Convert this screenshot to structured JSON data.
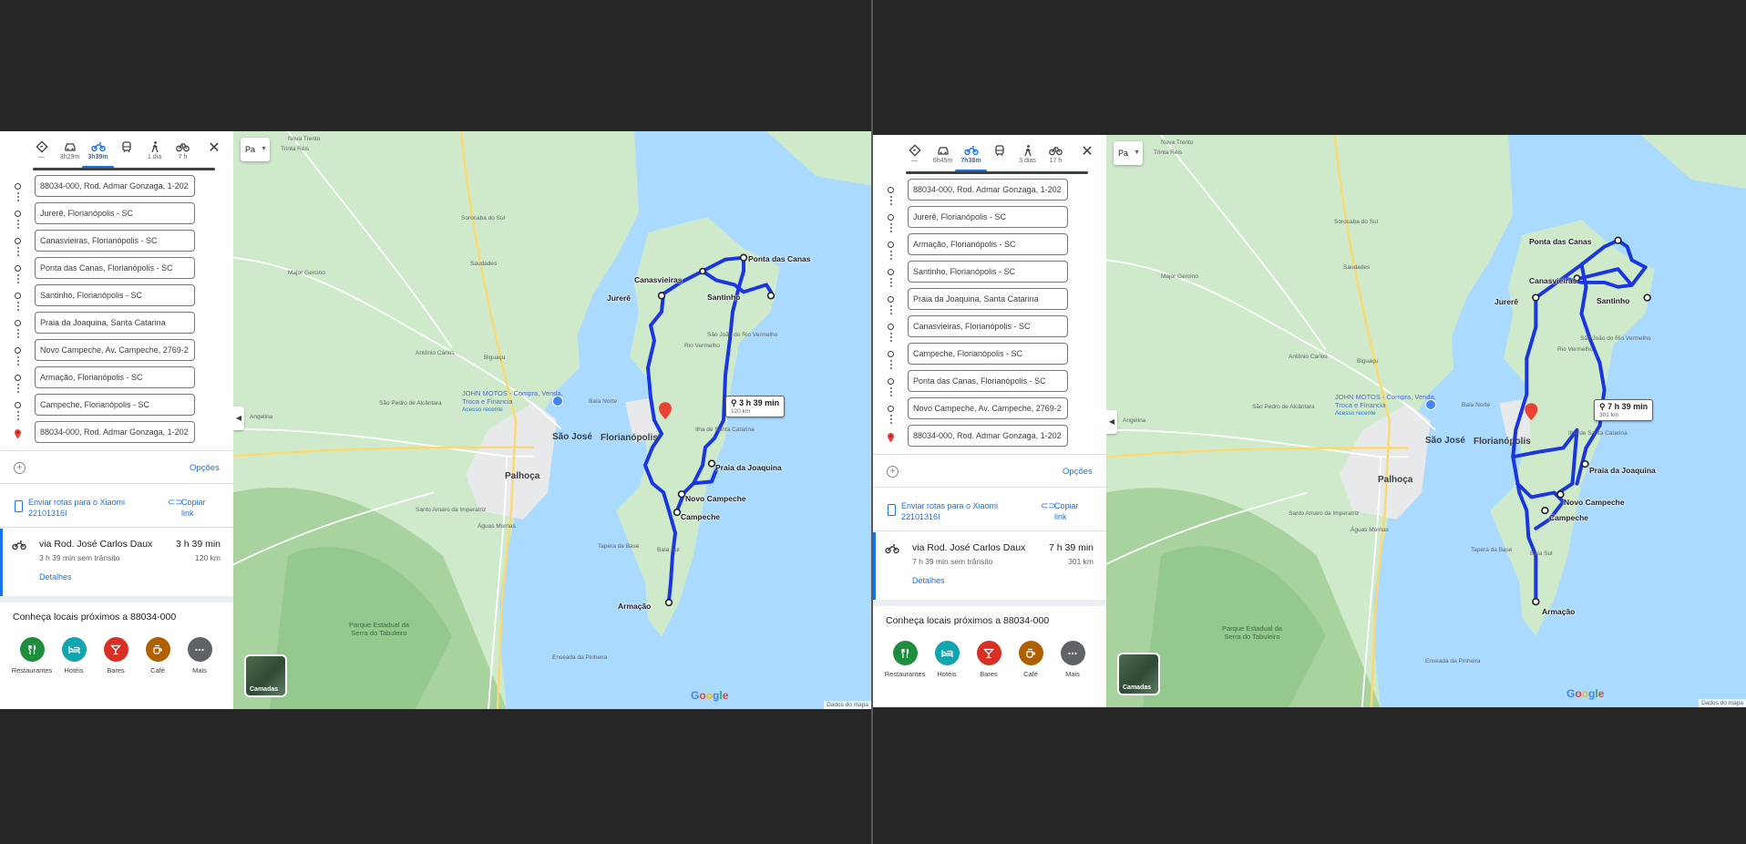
{
  "panes": [
    {
      "modes": [
        {
          "icon": "best-route-icon",
          "time": "—"
        },
        {
          "icon": "car-icon",
          "time": "3h29m"
        },
        {
          "icon": "motorcycle-icon",
          "time": "3h39m",
          "selected": true
        },
        {
          "icon": "transit-icon",
          "time": ""
        },
        {
          "icon": "walk-icon",
          "time": "1 dia"
        },
        {
          "icon": "bicycle-icon",
          "time": "7 h"
        }
      ],
      "stops": [
        "88034-000, Rod. Admar Gonzaga, 1-202",
        "Jurerê, Florianópolis - SC",
        "Canasvieiras, Florianópolis - SC",
        "Ponta das Canas, Florianópolis - SC",
        "Santinho, Florianópolis - SC",
        "Praia da Joaquina, Santa Catarina",
        "Novo Campeche, Av. Campeche, 2769-2",
        "Armação, Florianópolis - SC",
        "Campeche, Florianópolis - SC",
        "88034-000, Rod. Admar Gonzaga, 1-202"
      ],
      "options_label": "Opções",
      "send_label": "Enviar rotas para o Xiaomi 22101316I",
      "copy_label": "Copiar link",
      "route": {
        "title": "via Rod. José Carlos Daux",
        "time": "3 h 39 min",
        "subtitle": "3 h 39 min sem trânsito",
        "distance": "120 km",
        "details": "Detalhes"
      },
      "nearby_title": "Conheça locais próximos a 88034-000",
      "categories": [
        {
          "label": "Restaurantes",
          "icon": "restaurant-icon",
          "color": "#1e8e3e"
        },
        {
          "label": "Hotéis",
          "icon": "hotel-icon",
          "color": "#12a4af"
        },
        {
          "label": "Bares",
          "icon": "bar-icon",
          "color": "#d93025"
        },
        {
          "label": "Café",
          "icon": "coffee-icon",
          "color": "#b06000"
        },
        {
          "label": "Mais",
          "icon": "more-icon",
          "color": "#5f6368"
        }
      ],
      "map": {
        "layer_toggle": "Pa",
        "layers_label": "Camadas",
        "time_box": {
          "time": "3 h 39 min",
          "distance": "120 km"
        },
        "destinations": [
          "Ponta das Canas",
          "Canasvieiras",
          "Jurerê",
          "Santinho",
          "Praia da Joaquina",
          "Novo Campeche",
          "Campeche",
          "Armação"
        ],
        "cities": [
          "São José",
          "Florianópolis",
          "Palhoça"
        ],
        "places": [
          "Nova Trento",
          "Trinta Réis",
          "Antônio Carlos",
          "São Pedro de Alcântara",
          "Santo Amaro da Imperatriz",
          "Águas Mornas",
          "Angelina",
          "Major Gercino",
          "Sorocaba do Sul",
          "Saudades",
          "Biguaçu",
          "Rio Vermelho",
          "São João do Rio Vermelho",
          "Ilha de Santa Catarina",
          "Enseada da Pinheira",
          "Baía Norte",
          "Baía Sul",
          "Tapera da Base"
        ],
        "business": "JOHN MOTOS - Compra, Venda, Troca e Financia",
        "business_sub": "Acesso recente",
        "park": "Parque Estadual da Serra do Tabuleiro",
        "google": "Google",
        "attribution": "Dados do mapa"
      }
    },
    {
      "modes": [
        {
          "icon": "best-route-icon",
          "time": "—"
        },
        {
          "icon": "car-icon",
          "time": "6h45m"
        },
        {
          "icon": "motorcycle-icon",
          "time": "7h38m",
          "selected": true
        },
        {
          "icon": "transit-icon",
          "time": ""
        },
        {
          "icon": "walk-icon",
          "time": "3 dias"
        },
        {
          "icon": "bicycle-icon",
          "time": "17 h"
        }
      ],
      "stops": [
        "88034-000, Rod. Admar Gonzaga, 1-202",
        "Jurerê, Florianópolis - SC",
        "Armação, Florianópolis - SC",
        "Santinho, Florianópolis - SC",
        "Praia da Joaquina, Santa Catarina",
        "Canasvieiras, Florianópolis - SC",
        "Campeche, Florianópolis - SC",
        "Ponta das Canas, Florianópolis - SC",
        "Novo Campeche, Av. Campeche, 2769-2",
        "88034-000, Rod. Admar Gonzaga, 1-202"
      ],
      "options_label": "Opções",
      "send_label": "Enviar rotas para o Xiaomi 22101316I",
      "copy_label": "Copiar link",
      "route": {
        "title": "via Rod. José Carlos Daux",
        "time": "7 h 39 min",
        "subtitle": "7 h 39 min sem trânsito",
        "distance": "301 km",
        "details": "Detalhes"
      },
      "nearby_title": "Conheça locais próximos a 88034-000",
      "categories": [
        {
          "label": "Restaurantes",
          "icon": "restaurant-icon",
          "color": "#1e8e3e"
        },
        {
          "label": "Hotéis",
          "icon": "hotel-icon",
          "color": "#12a4af"
        },
        {
          "label": "Bares",
          "icon": "bar-icon",
          "color": "#d93025"
        },
        {
          "label": "Café",
          "icon": "coffee-icon",
          "color": "#b06000"
        },
        {
          "label": "Mais",
          "icon": "more-icon",
          "color": "#5f6368"
        }
      ],
      "map": {
        "layer_toggle": "Pa",
        "layers_label": "Camadas",
        "time_box": {
          "time": "7 h 39 min",
          "distance": "301 km"
        },
        "destinations": [
          "Ponta das Canas",
          "Canasvieiras",
          "Jurerê",
          "Santinho",
          "Praia da Joaquina",
          "Novo Campeche",
          "Campeche",
          "Armação"
        ],
        "cities": [
          "São José",
          "Florianópolis",
          "Palhoça"
        ],
        "places": [
          "Nova Trento",
          "Trinta Réis",
          "Antônio Carlos",
          "São Pedro de Alcântara",
          "Santo Amaro da Imperatriz",
          "Águas Mornas",
          "Angelina",
          "Major Gercino",
          "Sorocaba do Sul",
          "Saudades",
          "Biguaçu",
          "Rio Vermelho",
          "São João do Rio Vermelho",
          "Ilha de Santa Catarina",
          "Enseada da Pinheira",
          "Baía Norte",
          "Baía Sul",
          "Tapera da Base"
        ],
        "business": "JOHN MOTOS - Compra, Venda, Troca e Financia",
        "business_sub": "Acesso recente",
        "park": "Parque Estadual da Serra do Tabuleiro",
        "google": "Google",
        "attribution": "Dados do mapa"
      }
    }
  ]
}
